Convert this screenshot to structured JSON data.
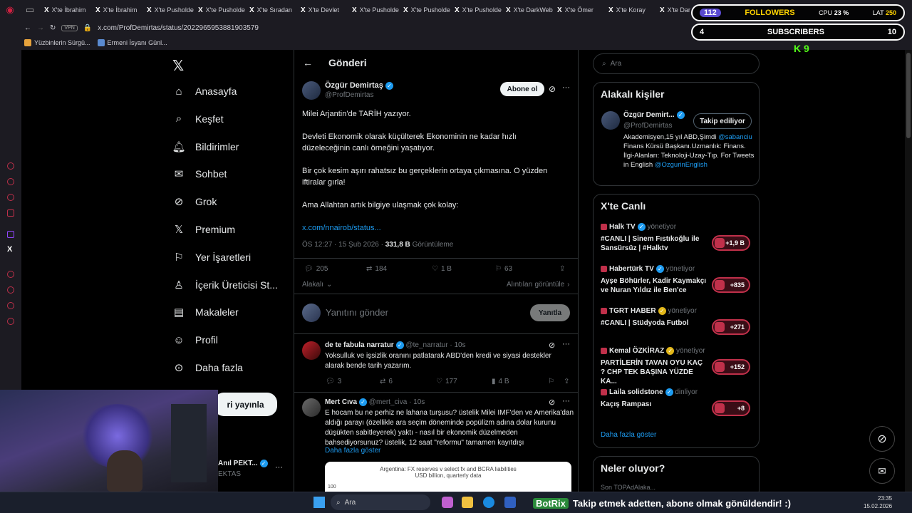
{
  "browser": {
    "tabs": [
      {
        "title": "X'te İbrahim"
      },
      {
        "title": "X'te İbrahim"
      },
      {
        "title": "X'te Pusholder"
      },
      {
        "title": "X'te Pusholder"
      },
      {
        "title": "X'te Sıradan"
      },
      {
        "title": "X'te Devlet"
      },
      {
        "title": "X'te Pusholder"
      },
      {
        "title": "X'te Pusholder"
      },
      {
        "title": "X'te Pusholder"
      },
      {
        "title": "X'te DarkWeb"
      },
      {
        "title": "X'te Ömer"
      },
      {
        "title": "X'te Koray"
      },
      {
        "title": "X'te Dar"
      }
    ],
    "url": "x.com/ProfDemirtas/status/2022965953881903579",
    "vpn_label": "VPN",
    "bookmarks": [
      "Yüzbinlerin Sürgü...",
      "Ermeni İsyanı Günl..."
    ]
  },
  "overlay": {
    "followers_count": "112",
    "followers_label": "FOLLOWERS",
    "subscribers_count": "4",
    "subscribers_label": "SUBSCRIBERS",
    "subscribers_goal": "10",
    "cpu_label": "CPU",
    "cpu_value": "23 %",
    "lat_label": "LAT",
    "lat_value": "250",
    "kick_badge": "K 9",
    "chat_user": "BotRix",
    "chat_message": "Takip etmek adetten, abone olmak gönüldendir! :)"
  },
  "nav": {
    "items": [
      {
        "label": "Anasayfa",
        "icon": "home-icon"
      },
      {
        "label": "Keşfet",
        "icon": "search-icon"
      },
      {
        "label": "Bildirimler",
        "icon": "bell-icon"
      },
      {
        "label": "Sohbet",
        "icon": "mail-icon"
      },
      {
        "label": "Grok",
        "icon": "grok-icon"
      },
      {
        "label": "Premium",
        "icon": "x-logo-icon"
      },
      {
        "label": "Yer İşaretleri",
        "icon": "bookmark-icon"
      },
      {
        "label": "İçerik Üreticisi St...",
        "icon": "creator-studio-icon"
      },
      {
        "label": "Makaleler",
        "icon": "article-icon"
      },
      {
        "label": "Profil",
        "icon": "user-icon"
      },
      {
        "label": "Daha fazla",
        "icon": "more-circle-icon"
      }
    ],
    "post_button": "ri yayınla",
    "account_name": "Anıl PEKT...",
    "account_handle": "EKTAS"
  },
  "main": {
    "header_title": "Gönderi",
    "post": {
      "author": "Özgür Demirtaş",
      "handle": "@ProfDemirtas",
      "subscribe": "Abone ol",
      "lines": [
        "Milei Arjantin'de TARİH yazıyor.",
        "Devleti Ekonomik olarak küçülterek Ekonominin ne kadar hızlı düzeleceğinin canlı örneğini yaşatıyor.",
        "Bir çok kesim aşırı rahatsız bu gerçeklerin ortaya çıkmasına. O yüzden iftiralar gırla!",
        "Ama Allahtan artık bilgiye ulaşmak çok kolay:"
      ],
      "link": "x.com/nnairob/status...",
      "time": "ÖS 12:27 · 15 Şub 2026 ·",
      "views": "331,8 B",
      "views_label": "Görüntüleme",
      "replies": "205",
      "reposts": "184",
      "likes": "1 B",
      "bookmarks": "63",
      "related_label": "Alakalı",
      "quotes_label": "Alıntıları görüntüle"
    },
    "reply_box": {
      "placeholder": "Yanıtını gönder",
      "button": "Yanıtla"
    },
    "replies": [
      {
        "author": "de te fabula narratur",
        "handle": "@te_narratur · 10s",
        "text": "Yoksulluk ve işsizlik oranını patlatarak ABD'den kredi ve siyasi destekler alarak bende tarih yazarım.",
        "replies": "3",
        "reposts": "6",
        "likes": "177",
        "views": "4 B"
      },
      {
        "author": "Mert Cıva",
        "handle": "@mert_civa · 10s",
        "text": "E hocam bu ne perhiz ne lahana turşusu? üstelik Milei IMF'den ve Amerika'dan aldığı parayı (özellikle ara seçim döneminde popülizm adına dolar kurunu düşükten sabitleyerek) yaktı - nasıl bir ekonomik düzelmeden bahsediyorsunuz? üstelik, 12 saat \"reformu\" tamamen kayıtdışı",
        "show_more": "Daha fazla göster",
        "chart_title": "Argentina: FX reserves v select fx and BCRA liabilities",
        "chart_subtitle": "USD billion, quarterly data",
        "chart_tick": "100"
      }
    ]
  },
  "right": {
    "search_placeholder": "Ara",
    "related_title": "Alakalı kişiler",
    "related_person": {
      "name": "Özgür Demirt...",
      "handle": "@ProfDemirtas",
      "button": "Takip ediliyor",
      "bio_1": "Akademisyen,15 yıl ABD,Şimdi",
      "bio_mention": "@sabanciu",
      "bio_2": " Finans Kürsü Başkanı.Uzmanlık: Finans. İlgi-Alanları: Teknoloji-Uzay-Tıp. For Tweets in English ",
      "bio_mention2": "@OzgurinEnglish"
    },
    "live_title": "X'te Canlı",
    "live_items": [
      {
        "host": "Halk TV",
        "role": "yönetiyor",
        "title": "#CANLI | Sinem Fıstıkoğlu ile Sansürsüz | #Halktv",
        "count": "+1,9 B"
      },
      {
        "host": "Habertürk TV",
        "role": "yönetiyor",
        "title": "Ayşe Böhürler, Kadir Kaymakçı ve Nuran Yıldız ile Ben'ce",
        "count": "+835"
      },
      {
        "host": "TGRT HABER",
        "role": "yönetiyor",
        "title": "#CANLI | Stüdyoda Futbol",
        "count": "+271"
      },
      {
        "host": "Kemal ÖZKİRAZ",
        "role": "yönetiyor",
        "title": "PARTİLERİN TAVAN OYU KAÇ ? CHP TEK BAŞINA YÜZDE KA...",
        "count": "+152"
      },
      {
        "host": "Laila solidstone",
        "role": "dinliyor",
        "title": "Kaçış Rampası",
        "count": "+8"
      }
    ],
    "show_more": "Daha fazla göster",
    "trends_title": "Neler oluyor?",
    "trend_peek": "Son TOPAdAlaka..."
  },
  "taskbar": {
    "search_placeholder": "Ara",
    "time": "23:35",
    "date": "15.02.2026"
  },
  "colors": {
    "accent": "#1d9bf0",
    "live_red": "#c0304a",
    "kick_green": "#53fc18"
  }
}
